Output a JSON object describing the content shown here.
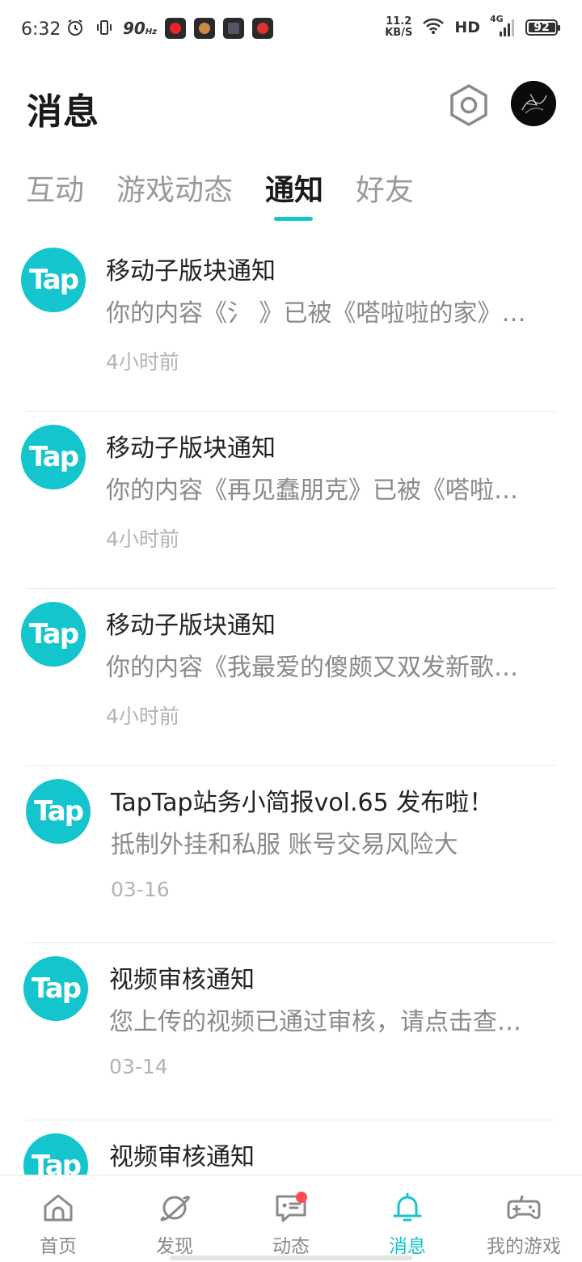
{
  "status_bar": {
    "time": "6:32",
    "refresh_rate": "90",
    "refresh_unit": "Hz",
    "net_speed_value": "11.2",
    "net_speed_unit": "KB/S",
    "hd": "HD",
    "network": "4G",
    "battery": "92"
  },
  "header": {
    "title": "消息"
  },
  "tabs": [
    {
      "label": "互动"
    },
    {
      "label": "游戏动态"
    },
    {
      "label": "通知"
    },
    {
      "label": "好友"
    }
  ],
  "active_tab": "通知",
  "logo_text": "Tap",
  "notifications": [
    {
      "title": "移动子版块通知",
      "body": "你的内容《氵 》已被《嗒啦啦的家》…",
      "time": "4小时前"
    },
    {
      "title": "移动子版块通知",
      "body": "你的内容《再见蠢朋克》已被《嗒啦…",
      "time": "4小时前"
    },
    {
      "title": "移动子版块通知",
      "body": "你的内容《我最爱的傻颇又双发新歌…",
      "time": "4小时前"
    },
    {
      "title": "TapTap站务小简报vol.65 发布啦！",
      "body": "抵制外挂和私服 账号交易风险大",
      "time": "03-16"
    },
    {
      "title": "视频审核通知",
      "body": "您上传的视频已通过审核，请点击查…",
      "time": "03-14"
    },
    {
      "title": "视频审核通知",
      "body": "",
      "time": ""
    }
  ],
  "bottom_nav": [
    {
      "label": "首页",
      "icon": "home-icon"
    },
    {
      "label": "发现",
      "icon": "planet-icon"
    },
    {
      "label": "动态",
      "icon": "chat-icon"
    },
    {
      "label": "消息",
      "icon": "bell-icon"
    },
    {
      "label": "我的游戏",
      "icon": "gamepad-icon"
    }
  ],
  "colors": {
    "accent": "#15c5ce",
    "badge": "#ff4d4f"
  }
}
